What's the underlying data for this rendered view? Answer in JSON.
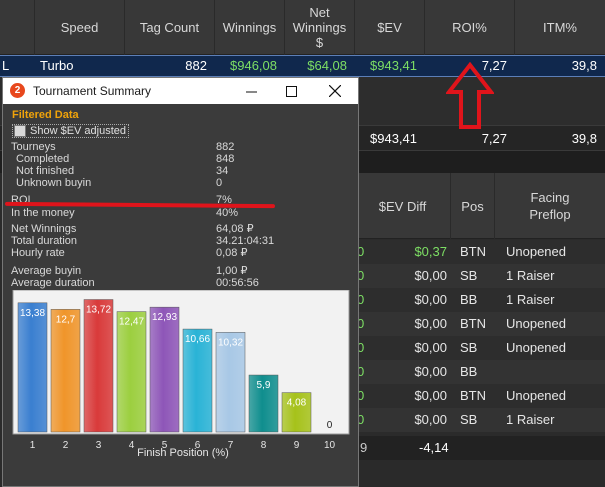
{
  "bg_header": {
    "col_speed": "Speed",
    "col_tag_count": "Tag Count",
    "col_winnings": "Winnings",
    "col_net_winnings": "Net Winnings $",
    "col_sev": "$EV",
    "col_roi": "ROI%",
    "col_itm": "ITM%"
  },
  "bg_selected_row": {
    "prefix": "L",
    "speed": "Turbo",
    "tag_count": "882",
    "winnings": "$946,08",
    "net_winnings": "$64,08",
    "sev": "$943,41",
    "roi": "7,27",
    "itm": "39,8"
  },
  "bg_total_row": {
    "sev": "$943,41",
    "roi": "7,27",
    "itm": "39,8"
  },
  "lower_grid": {
    "col_sev_diff": "$EV Diff",
    "col_pos": "Pos",
    "col_facing": "Facing Preflop",
    "rows": [
      {
        "left": "0",
        "diff": "$0,37",
        "pos": "BTN",
        "facing": "Unopened"
      },
      {
        "left": "0",
        "diff": "$0,00",
        "pos": "SB",
        "facing": "1 Raiser"
      },
      {
        "left": "0",
        "diff": "$0,00",
        "pos": "BB",
        "facing": "1 Raiser"
      },
      {
        "left": "0",
        "diff": "$0,00",
        "pos": "BTN",
        "facing": "Unopened"
      },
      {
        "left": "0",
        "diff": "$0,00",
        "pos": "SB",
        "facing": "Unopened"
      },
      {
        "left": "0",
        "diff": "$0,00",
        "pos": "BB",
        "facing": ""
      },
      {
        "left": "0",
        "diff": "$0,00",
        "pos": "BTN",
        "facing": "Unopened"
      },
      {
        "left": "0",
        "diff": "$0,00",
        "pos": "SB",
        "facing": "1 Raiser"
      }
    ],
    "total_left": "9",
    "total_diff": "-4,14"
  },
  "dialog": {
    "title": "Tournament Summary",
    "logo": "2",
    "filtered_label": "Filtered Data",
    "show_sev_label": "Show $EV adjusted",
    "minimize_icon": "minimize-icon",
    "maximize_icon": "maximize-icon",
    "close_icon": "close-icon"
  },
  "stats": {
    "tourneys_label": "Tourneys",
    "tourneys_value": "882",
    "completed_label": "Completed",
    "completed_value": "848",
    "not_finished_label": "Not finished",
    "not_finished_value": "34",
    "unknown_buyin_label": "Unknown buyin",
    "unknown_buyin_value": "0",
    "roi_label": "ROI",
    "roi_value": "7%",
    "itm_label": "In the money",
    "itm_value": "40%",
    "net_winnings_label": "Net Winnings",
    "net_winnings_value": "64,08 ₽",
    "total_duration_label": "Total duration",
    "total_duration_value": "34.21:04:31",
    "hourly_rate_label": "Hourly rate",
    "hourly_rate_value": "0,08 ₽",
    "average_buyin_label": "Average buyin",
    "average_buyin_value": "1,00 ₽",
    "average_duration_label": "Average duration",
    "average_duration_value": "00:56:56"
  },
  "colors": {
    "annotation": "#e0141b",
    "green_text": "#7ddf64",
    "filtered_label": "#f0a30a"
  },
  "chart_data": {
    "type": "bar",
    "categories": [
      "1",
      "2",
      "3",
      "4",
      "5",
      "6",
      "7",
      "8",
      "9",
      "10"
    ],
    "values": [
      13.38,
      12.7,
      13.72,
      12.47,
      12.93,
      10.66,
      10.32,
      5.9,
      4.08,
      0
    ],
    "value_labels": [
      "13,38",
      "12,7",
      "13,72",
      "12,47",
      "12,93",
      "10,66",
      "10,32",
      "5,9",
      "4,08",
      "0"
    ],
    "colors": [
      "#3a7fd0",
      "#f0952a",
      "#d93a3a",
      "#9ccf3f",
      "#8e56b8",
      "#29b3d6",
      "#a8c8e6",
      "#0f8e8e",
      "#a6c21a",
      "#a6c21a"
    ],
    "xlabel": "Finish Position (%)",
    "ylabel": "",
    "ylim": [
      0,
      14.5
    ]
  }
}
